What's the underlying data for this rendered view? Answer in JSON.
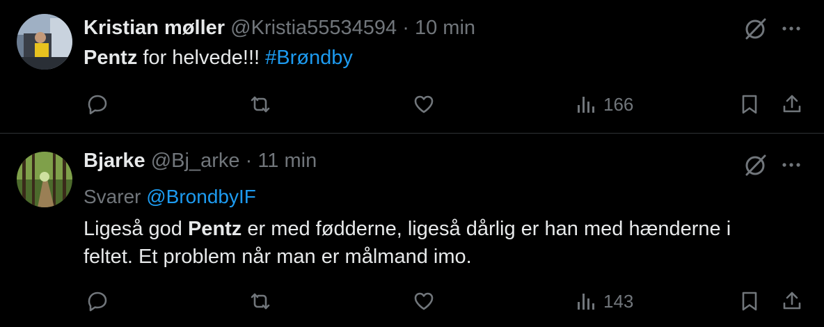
{
  "tweets": [
    {
      "author": "Kristian møller",
      "handle": "@Kristia55534594",
      "separator": "·",
      "time": "10 min",
      "text_bold": "Pentz",
      "text_rest": " for helvede!!! ",
      "hashtag": "#Brøndby",
      "views": "166"
    },
    {
      "author": "Bjarke",
      "handle": "@Bj_arke",
      "separator": "·",
      "time": "11 min",
      "reply_prefix": "Svarer",
      "reply_to": "@BrondbyIF",
      "text_a": "Ligeså god ",
      "text_bold": "Pentz",
      "text_b": " er med fødderne, ligeså dårlig er han med hænderne i feltet. Et problem når man er målmand imo.",
      "views": "143"
    }
  ],
  "colors": {
    "background": "#000000",
    "text": "#e7e9ea",
    "muted": "#71767b",
    "accent": "#1d9bf0",
    "divider": "#2f3336"
  },
  "icons": [
    "grok-icon",
    "more-icon",
    "reply-icon",
    "retweet-icon",
    "like-icon",
    "views-icon",
    "bookmark-icon",
    "share-icon"
  ]
}
